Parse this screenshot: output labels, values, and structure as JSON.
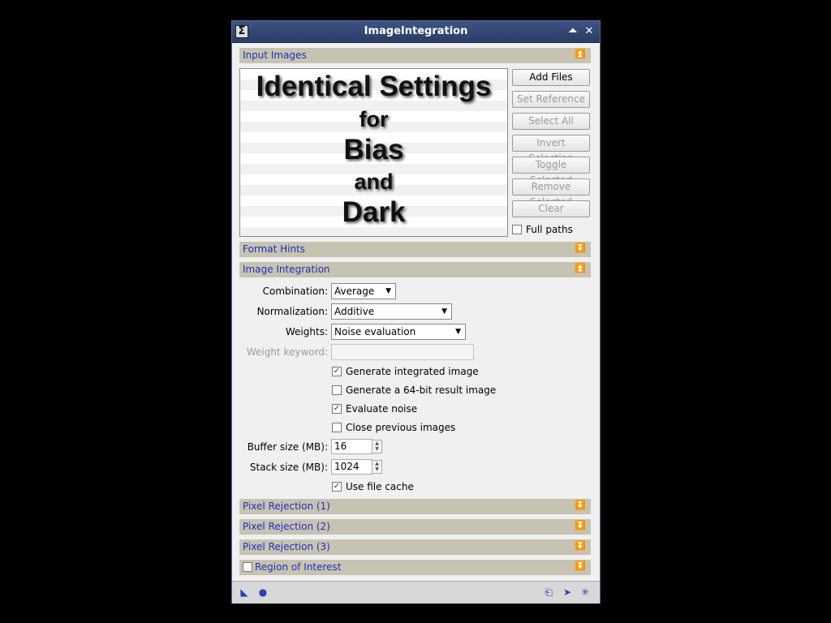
{
  "window": {
    "title": "ImageIntegration"
  },
  "sections": {
    "input_images": "Input Images",
    "format_hints": "Format Hints",
    "image_integration": "Image Integration",
    "pixel_rejection_1": "Pixel Rejection (1)",
    "pixel_rejection_2": "Pixel Rejection (2)",
    "pixel_rejection_3": "Pixel Rejection (3)",
    "region_of_interest": "Region of Interest"
  },
  "overlay": {
    "line1": "Identical Settings",
    "line2": "for",
    "line3": "Bias",
    "line4": "and",
    "line5": "Dark"
  },
  "buttons": {
    "add_files": "Add Files",
    "set_reference": "Set Reference",
    "select_all": "Select All",
    "invert_selection": "Invert Selection",
    "toggle_selected": "Toggle Selected",
    "remove_selected": "Remove Selected",
    "clear": "Clear"
  },
  "full_paths": {
    "label": "Full paths",
    "checked": false
  },
  "integration": {
    "combination_label": "Combination:",
    "combination_value": "Average",
    "normalization_label": "Normalization:",
    "normalization_value": "Additive",
    "weights_label": "Weights:",
    "weights_value": "Noise evaluation",
    "weight_keyword_label": "Weight keyword:",
    "weight_keyword_value": "",
    "generate_integrated": {
      "label": "Generate integrated image",
      "checked": true
    },
    "generate_64bit": {
      "label": "Generate a 64-bit result image",
      "checked": false
    },
    "evaluate_noise": {
      "label": "Evaluate noise",
      "checked": true
    },
    "close_previous": {
      "label": "Close previous images",
      "checked": false
    },
    "buffer_size_label": "Buffer size (MB):",
    "buffer_size_value": "16",
    "stack_size_label": "Stack size (MB):",
    "stack_size_value": "1024",
    "use_file_cache": {
      "label": "Use file cache",
      "checked": true
    }
  },
  "region_of_interest_checked": false,
  "icons": {
    "collapse": "▲",
    "expand": "▼",
    "checkmark": "✓"
  }
}
